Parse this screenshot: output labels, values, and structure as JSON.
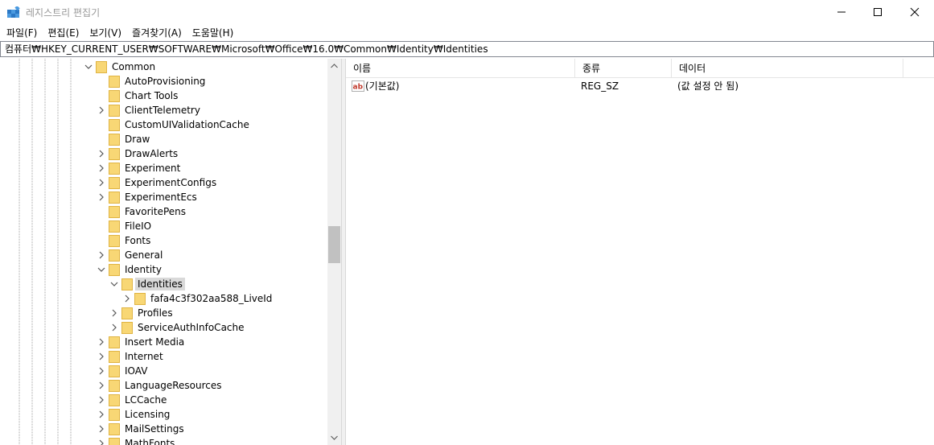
{
  "window": {
    "title": "레지스트리 편집기",
    "icon": "registry-editor-icon"
  },
  "menu": [
    "파일(F)",
    "편집(E)",
    "보기(V)",
    "즐겨찾기(A)",
    "도움말(H)"
  ],
  "address": "컴퓨터₩HKEY_CURRENT_USER₩SOFTWARE₩Microsoft₩Office₩16.0₩Common₩Identity₩Identities",
  "tree": {
    "items": [
      {
        "label": "Common",
        "level": 0,
        "expander": "expanded",
        "selected": false
      },
      {
        "label": "AutoProvisioning",
        "level": 1,
        "expander": "none",
        "selected": false
      },
      {
        "label": "Chart Tools",
        "level": 1,
        "expander": "none",
        "selected": false
      },
      {
        "label": "ClientTelemetry",
        "level": 1,
        "expander": "collapsed",
        "selected": false
      },
      {
        "label": "CustomUIValidationCache",
        "level": 1,
        "expander": "none",
        "selected": false
      },
      {
        "label": "Draw",
        "level": 1,
        "expander": "none",
        "selected": false
      },
      {
        "label": "DrawAlerts",
        "level": 1,
        "expander": "collapsed",
        "selected": false
      },
      {
        "label": "Experiment",
        "level": 1,
        "expander": "collapsed",
        "selected": false
      },
      {
        "label": "ExperimentConfigs",
        "level": 1,
        "expander": "collapsed",
        "selected": false
      },
      {
        "label": "ExperimentEcs",
        "level": 1,
        "expander": "collapsed",
        "selected": false
      },
      {
        "label": "FavoritePens",
        "level": 1,
        "expander": "none",
        "selected": false
      },
      {
        "label": "FileIO",
        "level": 1,
        "expander": "none",
        "selected": false
      },
      {
        "label": "Fonts",
        "level": 1,
        "expander": "none",
        "selected": false
      },
      {
        "label": "General",
        "level": 1,
        "expander": "collapsed",
        "selected": false
      },
      {
        "label": "Identity",
        "level": 1,
        "expander": "expanded",
        "selected": false
      },
      {
        "label": "Identities",
        "level": 2,
        "expander": "expanded",
        "selected": true
      },
      {
        "label": "fafa4c3f302aa588_LiveId",
        "level": 3,
        "expander": "collapsed",
        "selected": false
      },
      {
        "label": "Profiles",
        "level": 2,
        "expander": "collapsed",
        "selected": false
      },
      {
        "label": "ServiceAuthInfoCache",
        "level": 2,
        "expander": "collapsed",
        "selected": false
      },
      {
        "label": "Insert Media",
        "level": 1,
        "expander": "collapsed",
        "selected": false
      },
      {
        "label": "Internet",
        "level": 1,
        "expander": "collapsed",
        "selected": false
      },
      {
        "label": "IOAV",
        "level": 1,
        "expander": "collapsed",
        "selected": false
      },
      {
        "label": "LanguageResources",
        "level": 1,
        "expander": "collapsed",
        "selected": false
      },
      {
        "label": "LCCache",
        "level": 1,
        "expander": "collapsed",
        "selected": false
      },
      {
        "label": "Licensing",
        "level": 1,
        "expander": "collapsed",
        "selected": false
      },
      {
        "label": "MailSettings",
        "level": 1,
        "expander": "collapsed",
        "selected": false
      },
      {
        "label": "MathFonts",
        "level": 1,
        "expander": "collapsed",
        "selected": false
      }
    ]
  },
  "list": {
    "columns": [
      "이름",
      "종류",
      "데이터"
    ],
    "rows": [
      {
        "icon": "string-value-icon",
        "name": "(기본값)",
        "type": "REG_SZ",
        "data": "(값 설정 안 됨)"
      }
    ]
  },
  "colors": {
    "folder": "#f8d775",
    "folder_edge": "#e0b443",
    "selection": "#d9d9d9",
    "scrollbar_track": "#f0f0f0",
    "scrollbar_thumb": "#c1c1c1",
    "title_text": "#999999"
  }
}
